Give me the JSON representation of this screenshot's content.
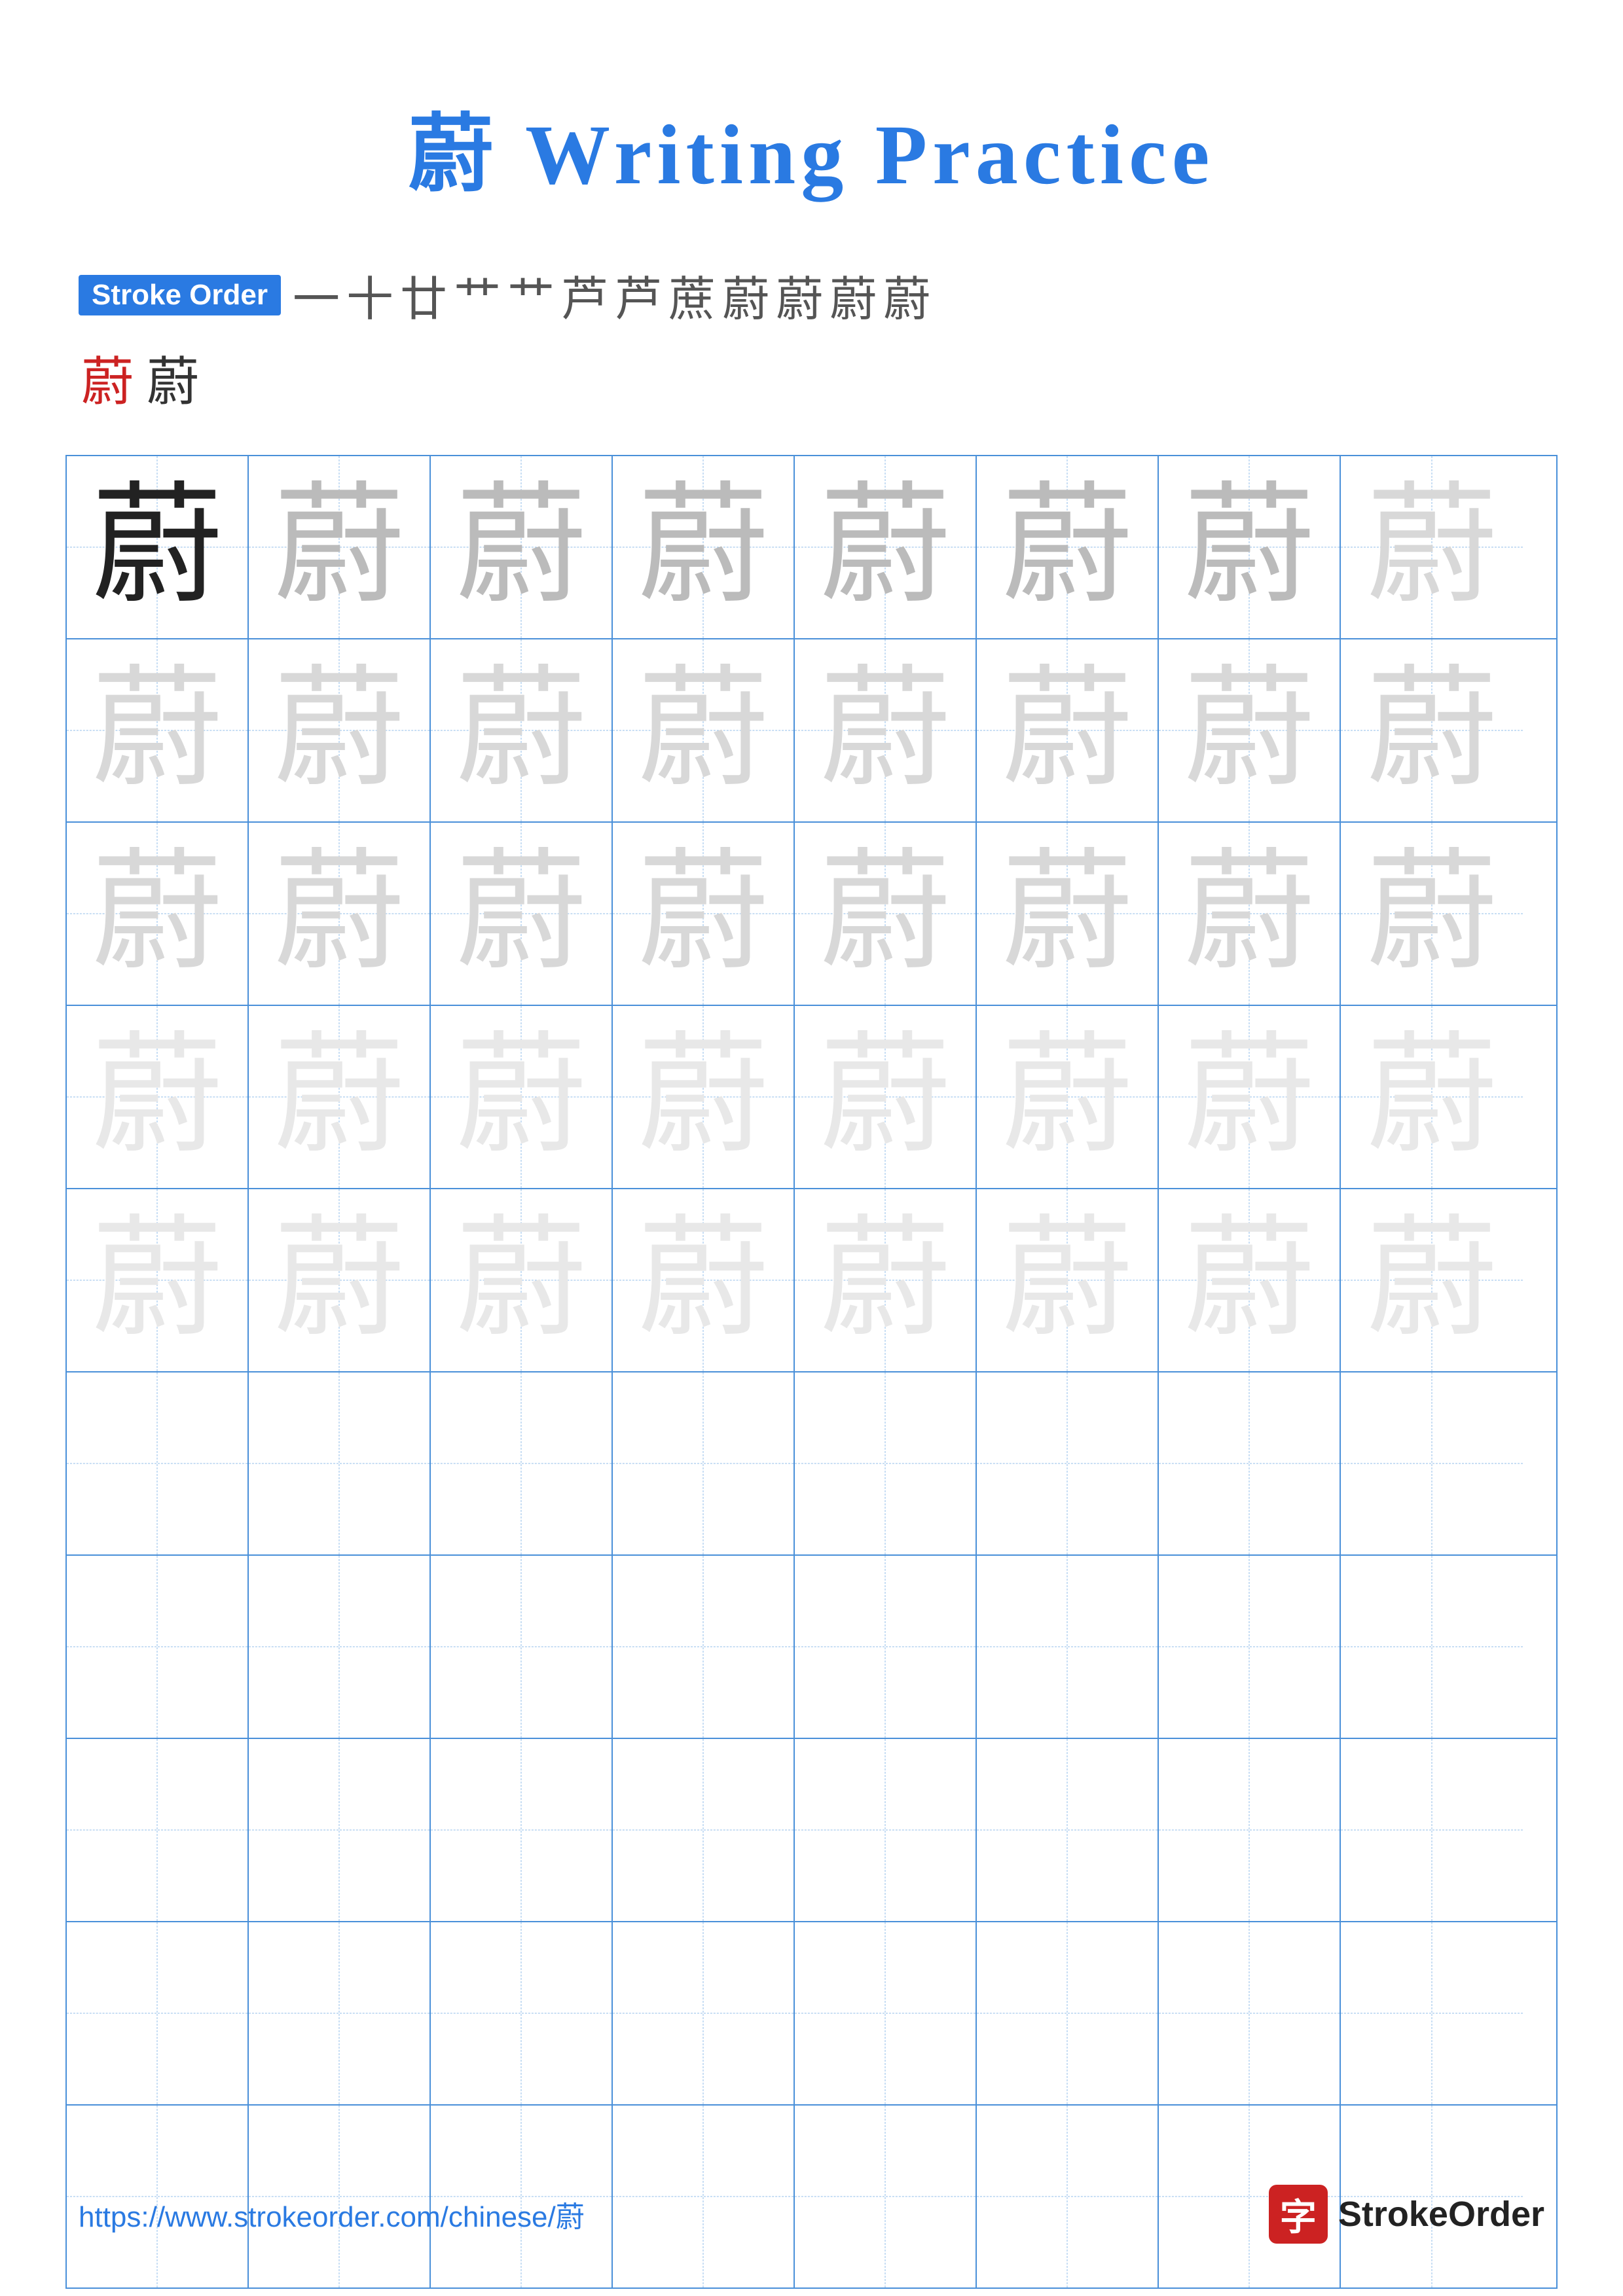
{
  "title": "蔚 Writing Practice",
  "stroke_order": {
    "badge_label": "Stroke Order",
    "strokes": [
      "一",
      "十",
      "廿",
      "艹",
      "艹",
      "芦",
      "芦",
      "蔗",
      "蔚",
      "蔚",
      "蔚",
      "蔚"
    ],
    "final_chars": [
      "蔚",
      "蔚"
    ]
  },
  "character": "蔚",
  "grid": {
    "cols": 8,
    "rows": 10,
    "practice_char_rows": 5,
    "empty_rows": 5
  },
  "footer": {
    "url": "https://www.strokeorder.com/chinese/蔚",
    "brand_char": "字",
    "brand_name": "StrokeOrder"
  }
}
